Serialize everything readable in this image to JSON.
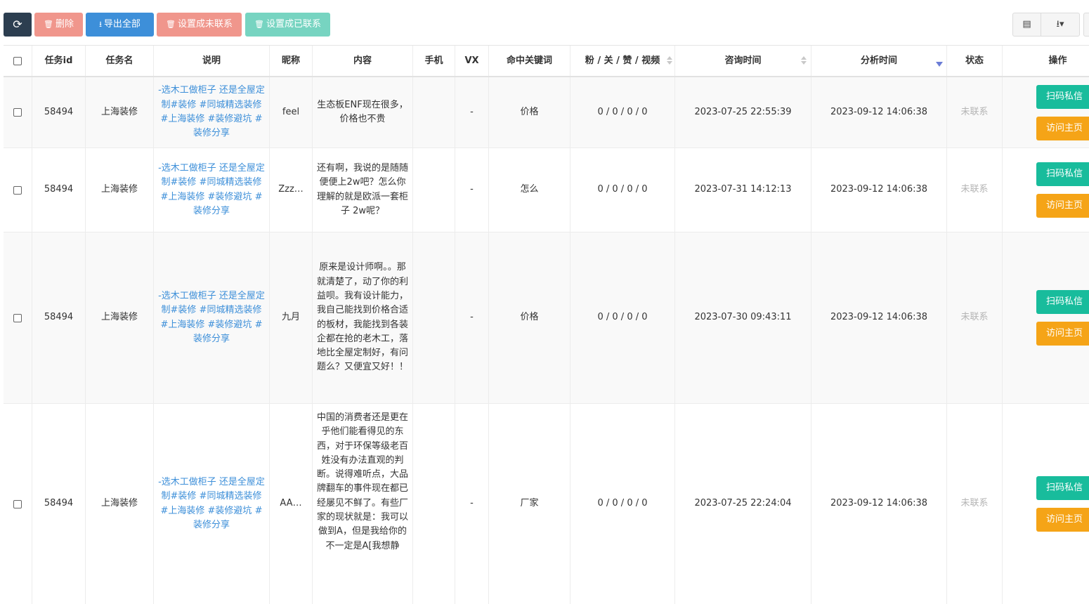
{
  "toolbar": {
    "refresh_icon": "⟳",
    "delete_label": "删除",
    "export_all_label": "导出全部",
    "set_uncontacted_label": "设置成未联系",
    "set_contacted_label": "设置成已联系",
    "trash_icon": "🗑",
    "download_icon": "⭳",
    "columns_icon": "▤",
    "export_menu_icon": "⭳▾"
  },
  "table": {
    "headers": {
      "task_id": "任务id",
      "task_name": "任务名",
      "description": "说明",
      "nickname": "昵称",
      "content": "内容",
      "phone": "手机",
      "vx": "VX",
      "keyword": "命中关键词",
      "stats": "粉 / 关 / 赞 / 视频",
      "consult_time": "咨询时间",
      "analysis_time": "分析时间",
      "status": "状态",
      "actions": "操作"
    },
    "rows": [
      {
        "task_id": "58494",
        "task_name": "上海装修",
        "description": "-选木工做柜子 还是全屋定制#装修 #同城精选装修 #上海装修 #装修避坑 #装修分享",
        "nickname": "feel",
        "content": "生态板ENF现在很多，价格也不贵",
        "phone": "",
        "vx": "-",
        "keyword": "价格",
        "stats": "0 / 0 / 0 / 0",
        "consult_time": "2023-07-25 22:55:39",
        "analysis_time": "2023-09-12 14:06:38",
        "status": "未联系",
        "msg_label": "扫码私信",
        "home_label": "访问主页"
      },
      {
        "task_id": "58494",
        "task_name": "上海装修",
        "description": "-选木工做柜子 还是全屋定制#装修 #同城精选装修 #上海装修 #装修避坑 #装修分享",
        "nickname": "Zzz…",
        "content": "还有啊，我说的是随随便便上2w吧？怎么你理解的就是欧派一套柜子 2w呢？",
        "phone": "",
        "vx": "-",
        "keyword": "怎么",
        "stats": "0 / 0 / 0 / 0",
        "consult_time": "2023-07-31 14:12:13",
        "analysis_time": "2023-09-12 14:06:38",
        "status": "未联系",
        "msg_label": "扫码私信",
        "home_label": "访问主页"
      },
      {
        "task_id": "58494",
        "task_name": "上海装修",
        "description": "-选木工做柜子 还是全屋定制#装修 #同城精选装修 #上海装修 #装修避坑 #装修分享",
        "nickname": "九月",
        "content": "原来是设计师啊。。那就清楚了，动了你的利益呗。我有设计能力，我自己能找到价格合适的板材，我能找到各装企都在抢的老木工，落地比全屋定制好，有问题么？又便宜又好！！",
        "phone": "",
        "vx": "-",
        "keyword": "价格",
        "stats": "0 / 0 / 0 / 0",
        "consult_time": "2023-07-30 09:43:11",
        "analysis_time": "2023-09-12 14:06:38",
        "status": "未联系",
        "msg_label": "扫码私信",
        "home_label": "访问主页"
      },
      {
        "task_id": "58494",
        "task_name": "上海装修",
        "description": "-选木工做柜子 还是全屋定制#装修 #同城精选装修 #上海装修 #装修避坑 #装修分享",
        "nickname": "AA…",
        "content": "中国的消费者还是更在乎他们能看得见的东西，对于环保等级老百姓没有办法直观的判断。说得难听点，大品牌翻车的事件现在都已经屡见不鲜了。有些厂家的现状就是：我可以做到A，但是我给你的不一定是A[我想静",
        "phone": "",
        "vx": "-",
        "keyword": "厂家",
        "stats": "0 / 0 / 0 / 0",
        "consult_time": "2023-07-25 22:24:04",
        "analysis_time": "2023-09-12 14:06:38",
        "status": "未联系",
        "msg_label": "扫码私信",
        "home_label": "访问主页"
      }
    ]
  }
}
